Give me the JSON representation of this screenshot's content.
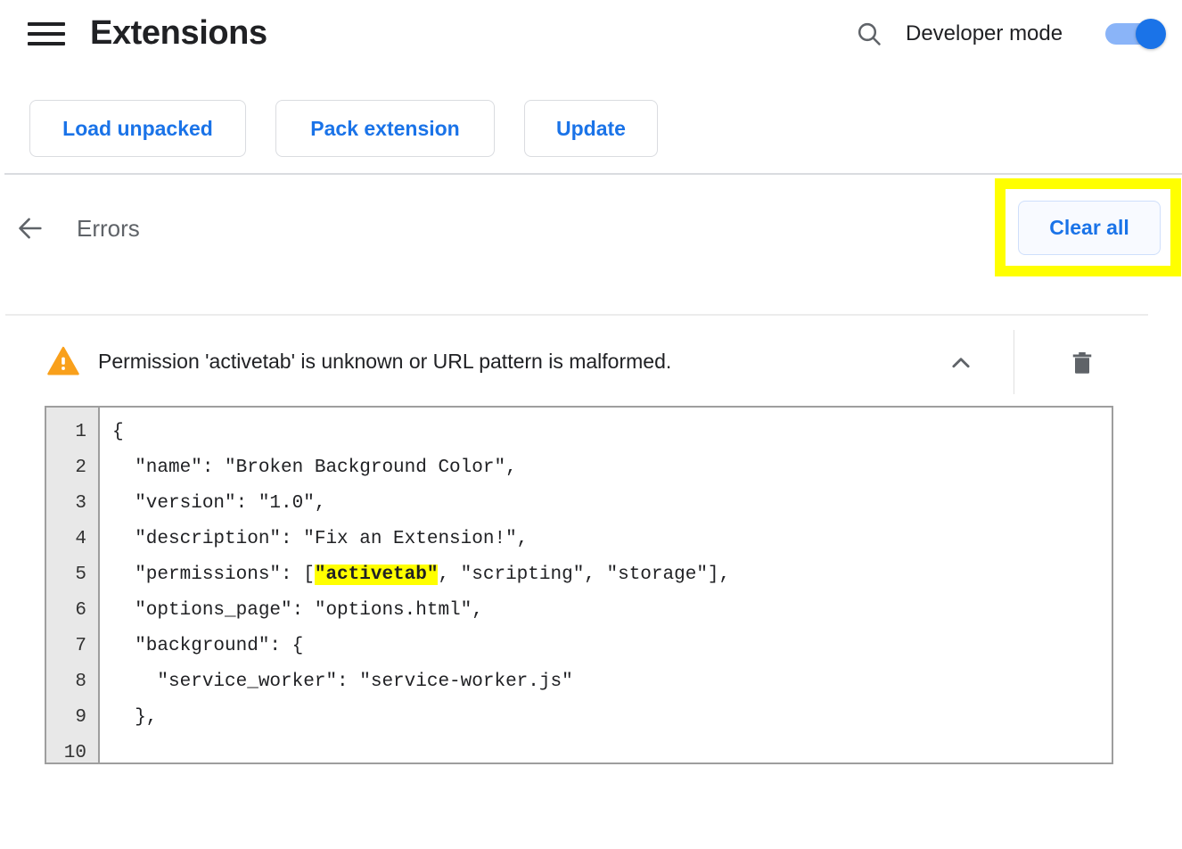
{
  "header": {
    "menu_icon": "hamburger-menu-icon",
    "title": "Extensions",
    "search_icon": "search-icon",
    "developer_mode_label": "Developer mode",
    "developer_mode_enabled": true
  },
  "toolbar": {
    "load_unpacked_label": "Load unpacked",
    "pack_extension_label": "Pack extension",
    "update_label": "Update"
  },
  "errors_section": {
    "back_icon": "arrow-left-icon",
    "heading": "Errors",
    "clear_all_label": "Clear all"
  },
  "error_item": {
    "severity_icon": "warning-triangle-icon",
    "message": "Permission 'activetab' is unknown or URL pattern is malformed.",
    "collapse_icon": "chevron-up-icon",
    "delete_icon": "trash-icon"
  },
  "code_viewer": {
    "line_numbers": [
      "1",
      "2",
      "3",
      "4",
      "5",
      "6",
      "7",
      "8",
      "9",
      "10"
    ],
    "lines": [
      {
        "pre": "{",
        "highlight": "",
        "post": ""
      },
      {
        "pre": "  \"name\": \"Broken Background Color\",",
        "highlight": "",
        "post": ""
      },
      {
        "pre": "  \"version\": \"1.0\",",
        "highlight": "",
        "post": ""
      },
      {
        "pre": "  \"description\": \"Fix an Extension!\",",
        "highlight": "",
        "post": ""
      },
      {
        "pre": "  \"permissions\": [",
        "highlight": "\"activetab\"",
        "post": ", \"scripting\", \"storage\"],"
      },
      {
        "pre": "  \"options_page\": \"options.html\",",
        "highlight": "",
        "post": ""
      },
      {
        "pre": "  \"background\": {",
        "highlight": "",
        "post": ""
      },
      {
        "pre": "    \"service_worker\": \"service-worker.js\"",
        "highlight": "",
        "post": ""
      },
      {
        "pre": "  },",
        "highlight": "",
        "post": ""
      },
      {
        "pre": "",
        "highlight": "",
        "post": ""
      }
    ]
  },
  "colors": {
    "accent_blue": "#1a73e8",
    "toggle_track": "#8ab4f8",
    "warning_orange": "#f9a825",
    "highlight_yellow": "#ffff00",
    "text_primary": "#202124",
    "text_secondary": "#5f6368",
    "border_gray": "#dadce0"
  }
}
